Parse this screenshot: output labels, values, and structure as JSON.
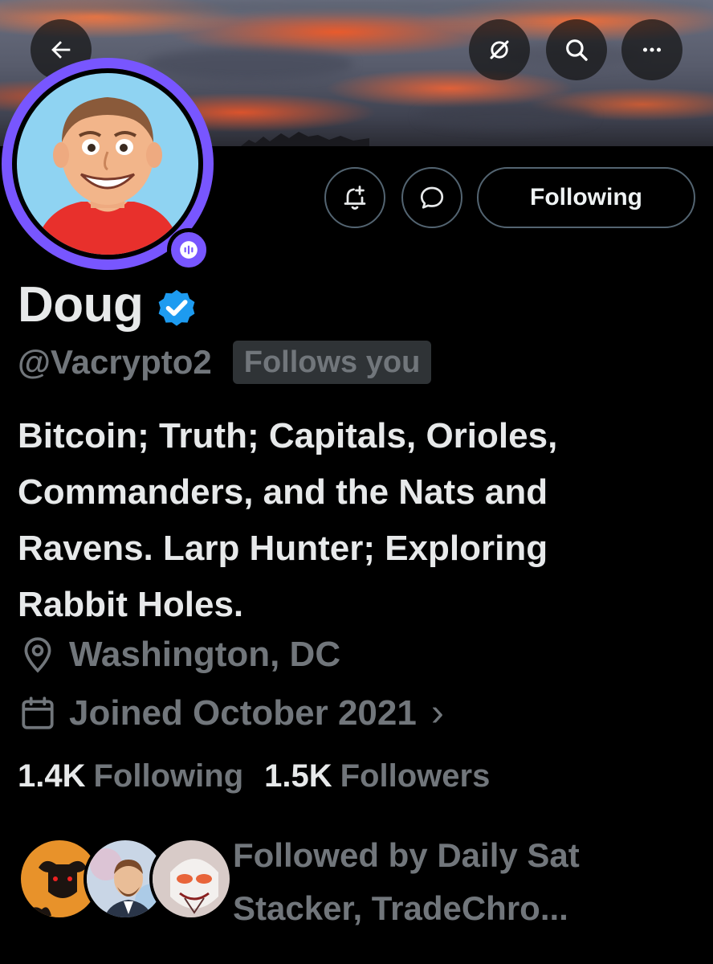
{
  "header": {
    "back_icon": "arrow-left-icon",
    "grok_icon": "grok-slash-icon",
    "search_icon": "search-icon",
    "more_icon": "more-dots-icon"
  },
  "profile": {
    "name": "Doug",
    "handle": "@Vacrypto2",
    "follows_you_label": "Follows you",
    "bio_lines": [
      "Bitcoin; Truth; Capitals, Orioles,",
      "Commanders, and the Nats and",
      "Ravens. Larp Hunter; Exploring",
      "Rabbit Holes."
    ],
    "location": "Washington, DC",
    "joined": "Joined October 2021",
    "joined_chevron": "›"
  },
  "actions": {
    "notify_icon": "bell-plus-icon",
    "message_icon": "chat-bubble-icon",
    "following_label": "Following"
  },
  "stats": {
    "following_count": "1.4K",
    "following_label": "Following",
    "followers_count": "1.5K",
    "followers_label": "Followers"
  },
  "followed_by": {
    "text_line1": "Followed by Daily Sat",
    "text_line2": "Stacker, TradeChro..."
  },
  "colors": {
    "accent_purple": "#7856ff",
    "verified_blue": "#1d9bf0",
    "muted_text": "#71767b",
    "border": "#536471"
  }
}
